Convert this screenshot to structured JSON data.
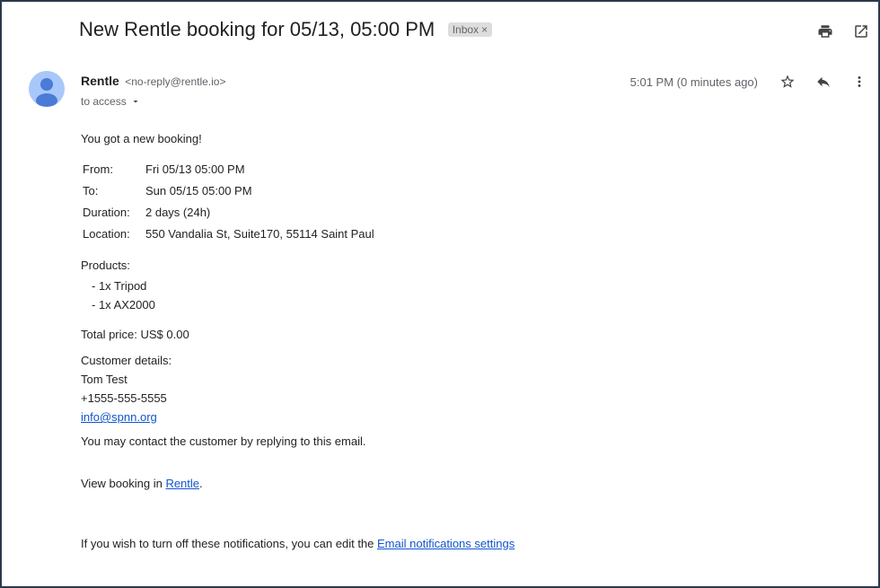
{
  "email": {
    "subject": "New Rentle booking for 05/13, 05:00 PM",
    "label": "Inbox",
    "label_close": "×",
    "sender_name": "Rentle",
    "sender_email": "<no-reply@rentle.io>",
    "recipient": "to access",
    "timestamp": "5:01 PM (0 minutes ago)"
  },
  "icons": {
    "print": "print-icon",
    "open_new": "open-in-new-window-icon",
    "star": "star-icon",
    "reply": "reply-icon",
    "more": "more-options-icon",
    "avatar": "avatar-icon",
    "dropdown": "chevron-down-icon"
  },
  "body": {
    "intro": "You got a new booking!",
    "details": [
      {
        "label": "From:",
        "value": "Fri 05/13 05:00 PM"
      },
      {
        "label": "To:",
        "value": "Sun 05/15 05:00 PM"
      },
      {
        "label": "Duration:",
        "value": "2 days (24h)"
      },
      {
        "label": "Location:",
        "value": "550 Vandalia St, Suite170, 55114 Saint Paul"
      }
    ],
    "products_label": "Products:",
    "products": [
      "- 1x Tripod",
      "- 1x AX2000"
    ],
    "total_price": "Total price: US$ 0.00",
    "customer_label": "Customer details:",
    "customer_name": "Tom Test",
    "customer_phone": "+1555-555-5555",
    "customer_email": "info@spnn.org",
    "contact_note": "You may contact the customer by replying to this email.",
    "view_prefix": "View booking in ",
    "view_link": "Rentle",
    "view_suffix": ".",
    "notif_prefix": "If you wish to turn off these notifications, you can edit the ",
    "notif_link": "Email notifications settings"
  }
}
